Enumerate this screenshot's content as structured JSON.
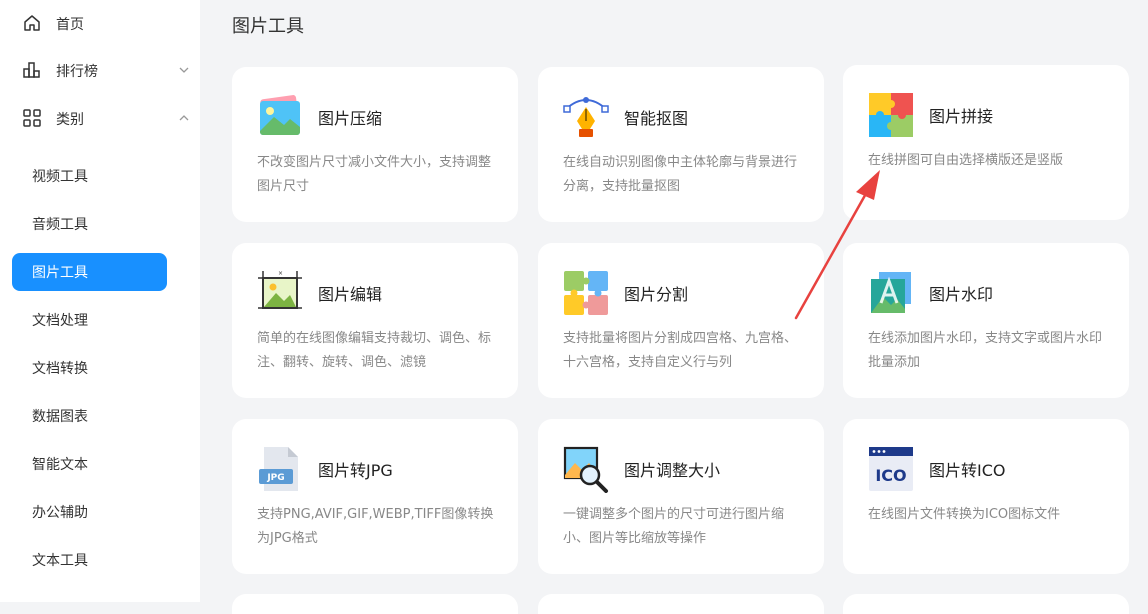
{
  "sidebar": {
    "top_items": [
      {
        "label": "首页",
        "icon": "home-icon"
      },
      {
        "label": "排行榜",
        "icon": "bar-chart-icon"
      },
      {
        "label": "类别",
        "icon": "grid-icon"
      }
    ],
    "sub_items": [
      {
        "label": "视频工具",
        "active": false
      },
      {
        "label": "音频工具",
        "active": false
      },
      {
        "label": "图片工具",
        "active": true
      },
      {
        "label": "文档处理",
        "active": false
      },
      {
        "label": "文档转换",
        "active": false
      },
      {
        "label": "数据图表",
        "active": false
      },
      {
        "label": "智能文本",
        "active": false
      },
      {
        "label": "办公辅助",
        "active": false
      },
      {
        "label": "文本工具",
        "active": false
      }
    ]
  },
  "main": {
    "title": "图片工具",
    "cards": [
      {
        "title": "图片压缩",
        "desc": "不改变图片尺寸减小文件大小，支持调整图片尺寸",
        "icon": "image-compress-icon"
      },
      {
        "title": "智能抠图",
        "desc": "在线自动识别图像中主体轮廓与背景进行分离，支持批量抠图",
        "icon": "pen-tool-icon"
      },
      {
        "title": "图片拼接",
        "desc": "在线拼图可自由选择横版还是竖版",
        "icon": "puzzle-icon"
      },
      {
        "title": "图片编辑",
        "desc": "简单的在线图像编辑支持裁切、调色、标注、翻转、旋转、调色、滤镜",
        "icon": "image-edit-icon"
      },
      {
        "title": "图片分割",
        "desc": "支持批量将图片分割成四宫格、九宫格、十六宫格，支持自定义行与列",
        "icon": "puzzle-split-icon"
      },
      {
        "title": "图片水印",
        "desc": "在线添加图片水印，支持文字或图片水印批量添加",
        "icon": "watermark-icon"
      },
      {
        "title": "图片转JPG",
        "desc": "支持PNG,AVIF,GIF,WEBP,TIFF图像转换为JPG格式",
        "icon": "jpg-file-icon",
        "badge": "JPG"
      },
      {
        "title": "图片调整大小",
        "desc": "一键调整多个图片的尺寸可进行图片缩小、图片等比缩放等操作",
        "icon": "image-resize-icon"
      },
      {
        "title": "图片转ICO",
        "desc": "在线图片文件转换为ICO图标文件",
        "icon": "ico-file-icon",
        "badge": "ICO"
      }
    ]
  },
  "colors": {
    "accent": "#1890ff",
    "annotation": "#e8423f"
  }
}
